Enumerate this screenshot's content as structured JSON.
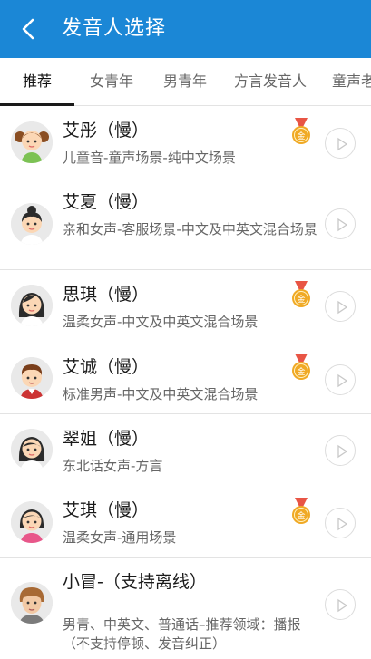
{
  "header": {
    "title": "发音人选择",
    "back_icon": "back-arrow-icon"
  },
  "tabs": [
    {
      "label": "推荐",
      "active": true
    },
    {
      "label": "女青年"
    },
    {
      "label": "男青年"
    },
    {
      "label": "方言发音人"
    },
    {
      "label": "童声老"
    }
  ],
  "speakers": [
    {
      "name": "艾彤（慢）",
      "desc": "儿童音-童声场景-纯中文场景",
      "medal": true,
      "medal_text": "金",
      "avatar": "girl-child-avatar"
    },
    {
      "name": "艾夏（慢）",
      "desc": "亲和女声-客服场景-中文及中英文混合场景",
      "medal": false,
      "avatar": "woman-bun-avatar"
    },
    {
      "name": "思琪（慢）",
      "desc": "温柔女声-中文及中英文混合场景",
      "medal": true,
      "medal_text": "金",
      "avatar": "woman-avatar"
    },
    {
      "name": "艾诚（慢）",
      "desc": "标准男声-中文及中英文混合场景",
      "medal": true,
      "medal_text": "金",
      "avatar": "man-avatar"
    },
    {
      "name": "翠姐（慢）",
      "desc": "东北话女声-方言",
      "medal": false,
      "avatar": "woman-avatar"
    },
    {
      "name": "艾琪（慢）",
      "desc": "温柔女声-通用场景",
      "medal": true,
      "medal_text": "金",
      "avatar": "girl-avatar"
    },
    {
      "name": "小冒-（支持离线）",
      "desc": "男青、中英文、普通话–推荐领域：播报（不支持停顿、发音纠正）",
      "medal": false,
      "avatar": "young-man-avatar"
    }
  ],
  "colors": {
    "appbar": "#1b87d6",
    "medal": "#f0a925",
    "medal_ribbon": "#e85545"
  }
}
